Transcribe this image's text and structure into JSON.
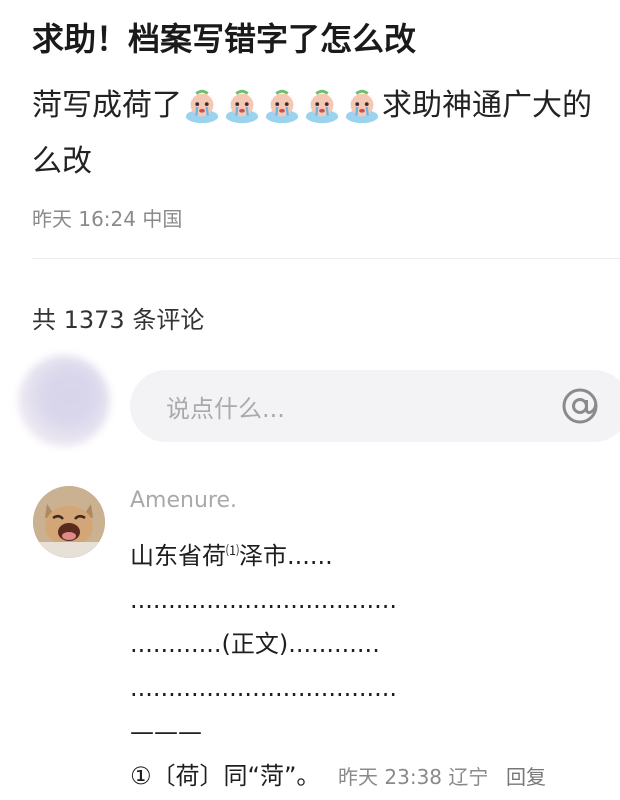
{
  "post": {
    "title": "求助！档案写错字了怎么改",
    "body_start": "菏写成荷了",
    "body_end": "求助神通广大的",
    "body_line2": "么改",
    "meta": "昨天 16:24 中国",
    "emoji_count": 5
  },
  "comments_count": "共 1373 条评论",
  "comment_input": {
    "placeholder": "说点什么..."
  },
  "comment": {
    "author": "Amenure.",
    "lines": [
      "山东省荷",
      "⑴",
      "泽市......",
      "...................................",
      "............(正文)............",
      "...................................",
      "———",
      "①〔荷〕同“菏”。"
    ],
    "time_location": "昨天 23:38 辽宁",
    "reply_label": "回复"
  },
  "colors": {
    "accent": "#1a1a1a",
    "meta": "#8a8a8a",
    "input_bg": "#f3f3f5"
  }
}
